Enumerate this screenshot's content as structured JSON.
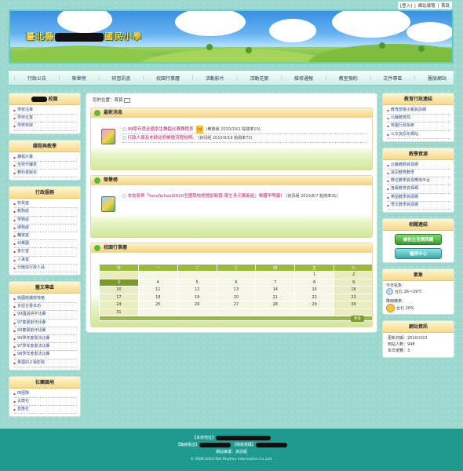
{
  "toplinks": [
    "登入",
    "網站導覽",
    "首頁"
  ],
  "banner": {
    "school_prefix": "臺北縣",
    "school_suffix": "國民小學"
  },
  "nav": [
    "行政公告",
    "榮譽榜",
    "研習訊息",
    "校園行事曆",
    "活動影片",
    "活動花絮",
    "維修通報",
    "教室預約",
    "文件專區",
    "舊版網站"
  ],
  "left": {
    "school": {
      "title": "校園",
      "items": [
        "學校沿革",
        "學校位置",
        "學校校歌"
      ]
    },
    "teaching": {
      "title": "課程與教學",
      "items": [
        "課程計畫",
        "全校作課表",
        "教科書版本"
      ]
    },
    "admin": {
      "title": "行政服務",
      "items": [
        "校長室",
        "教務處",
        "學務處",
        "總務處",
        "輔導室",
        "幼稚園",
        "會計室",
        "人事室",
        "分機與行政人員"
      ]
    },
    "special": {
      "title": "藝文專區",
      "items": [
        "桃園閱讀部落格",
        "多語言書本坊",
        "99國語拼字比賽",
        "97童書創作比賽",
        "99童書創作比賽",
        "99學年度書法比賽",
        "97學年度書法比賽",
        "98學年度書法比賽",
        "喬裡的子電影院"
      ]
    },
    "club": {
      "title": "社團園地",
      "items": [
        "田徑隊",
        "太鼓社",
        "直笛社"
      ]
    }
  },
  "breadcrumb": {
    "label": "您的位置：首頁",
    "page": ""
  },
  "news": {
    "title": "最新消息",
    "rows": [
      {
        "title": "99學年度全國學生舞蹈比賽賽程表",
        "hot": "hot",
        "meta": "(教務組 2010/10/1 點閱率10)"
      },
      {
        "title": "行政人員及老師註冊帳號流程說明。",
        "hot": "",
        "meta": "(資訊組 2010/9/19 點閱率73)"
      }
    ]
  },
  "honor": {
    "title": "榮譽榜",
    "text": "本校參與「InnoSchool2010全國學校經營創新獎-學生多元展能組」榮獲甲等獎！",
    "meta": "(資訊組 2010/8/7 點閱率31)"
  },
  "calendar": {
    "title": "校園行事曆",
    "headers": [
      "日",
      "一",
      "二",
      "三",
      "四",
      "五",
      "六"
    ],
    "weeks": [
      [
        "",
        "",
        "",
        "",
        "",
        "1",
        "2"
      ],
      [
        "3",
        "4",
        "5",
        "6",
        "7",
        "8",
        "9"
      ],
      [
        "10",
        "11",
        "12",
        "13",
        "14",
        "15",
        "16"
      ],
      [
        "17",
        "18",
        "19",
        "20",
        "21",
        "22",
        "23"
      ],
      [
        "24",
        "25",
        "26",
        "27",
        "28",
        "29",
        "30"
      ],
      [
        "31",
        "",
        "",
        "",
        "",
        "",
        ""
      ]
    ],
    "today": "3",
    "more": "更多"
  },
  "right": {
    "edu": {
      "title": "教育行政連結",
      "items": [
        "教育部電子報資訊網",
        "北縣教育局",
        "校園行政系統",
        "公文資訊化網站"
      ]
    },
    "resource": {
      "title": "教學資源",
      "items": [
        "北縣教師資源網",
        "資訊教育教學",
        "數位教學資源應用平台",
        "各級教育資源網",
        "英語教學資源網",
        "學文教學資源網"
      ]
    },
    "links": {
      "title": "相關連結",
      "buttons": [
        "綠色生活資訊網",
        "優良中心"
      ]
    },
    "weather": {
      "title": "氣象",
      "today_label": "今日氣象：",
      "today_value": "台北 26～29℃",
      "forecast_label": "降雨機率：",
      "forecast_value": "台北 20%"
    },
    "stats": {
      "title": "網站資訊",
      "lines": [
        "更新日期：2010/10/2",
        "到站人數：948",
        "本日瀏覽：3"
      ]
    }
  },
  "footer": {
    "address_label": "【本校地址】",
    "phone_label": "【聯絡電話】",
    "fax_label": "【傳真號碼】",
    "maintainer": "網站維護：資訊組",
    "copyright": "© 2006-2010 Net Rhythm Information Co.,Ltd."
  }
}
